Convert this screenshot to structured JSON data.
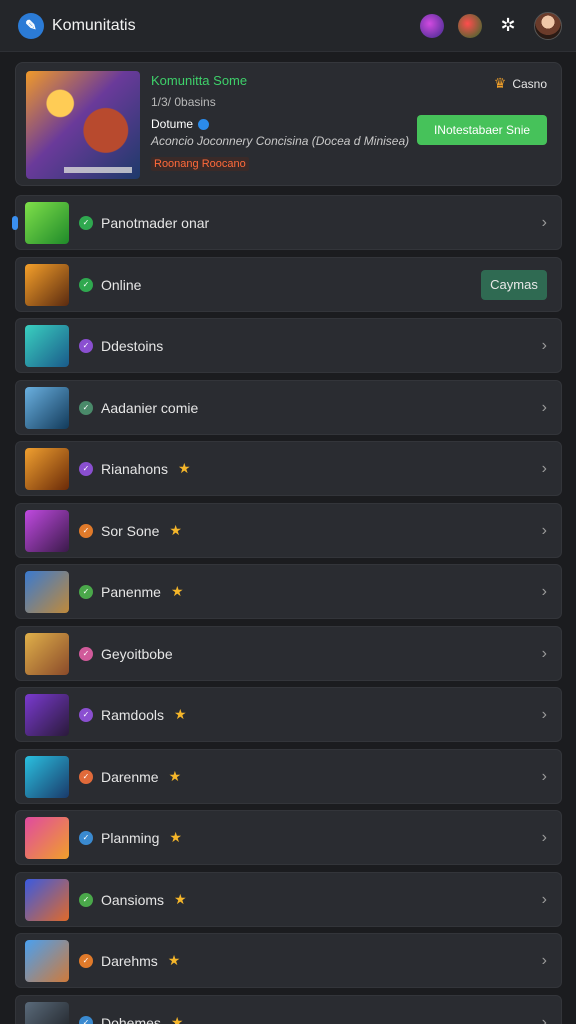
{
  "app": {
    "title": "Komunitatis"
  },
  "top_icons": [
    "game-icon",
    "award-icon",
    "gear-icon",
    "avatar"
  ],
  "featured": {
    "name": "Komunitta Some",
    "subtitle": "1/3/ 0basins",
    "owner": "Dotume",
    "description": "Aconcio Joconnery Concisina (Docea d Minisea)",
    "tag": "Roonang Roocano",
    "badge": "Casno",
    "button": "INotestabaer Snie"
  },
  "rows": [
    {
      "label": "Panotmader onar",
      "status_color": "#2fa84f",
      "type": "chevron",
      "thumb": "green"
    },
    {
      "label": "Online",
      "status_color": "#2fa84f",
      "type": "button",
      "button": "Caymas",
      "thumb": "orange"
    },
    {
      "label": "Ddestoins",
      "status_color": "#8a4fd0",
      "type": "chevron",
      "thumb": "teal"
    },
    {
      "label": "Aadanier comie",
      "status_color": "#4a8a6a",
      "type": "chevron",
      "thumb": "blue"
    },
    {
      "label": "Rianahons",
      "status_color": "#8a4fd0",
      "type": "star-chevron",
      "thumb": "amber"
    },
    {
      "label": "Sor Sone",
      "status_color": "#e07a2a",
      "type": "star-chevron",
      "thumb": "purple"
    },
    {
      "label": "Panenme",
      "status_color": "#4aa84a",
      "type": "star-chevron",
      "thumb": "desert"
    },
    {
      "label": "Geyoitbobe",
      "status_color": "#d05a9a",
      "type": "chevron",
      "thumb": "gold"
    },
    {
      "label": "Ramdools",
      "status_color": "#8a4fd0",
      "type": "star-chevron",
      "thumb": "violet"
    },
    {
      "label": "Darenme",
      "status_color": "#e06a3a",
      "type": "star-chevron",
      "thumb": "cyan"
    },
    {
      "label": "Planming",
      "status_color": "#3a8ad0",
      "type": "star-chevron",
      "thumb": "sunset"
    },
    {
      "label": "Oansioms",
      "status_color": "#4aa84a",
      "type": "star-chevron",
      "thumb": "navy"
    },
    {
      "label": "Darehms",
      "status_color": "#e07a2a",
      "type": "star-chevron",
      "thumb": "sky"
    },
    {
      "label": "Dohemes",
      "status_color": "#3a8ad0",
      "type": "star-chevron",
      "thumb": "dark"
    }
  ]
}
